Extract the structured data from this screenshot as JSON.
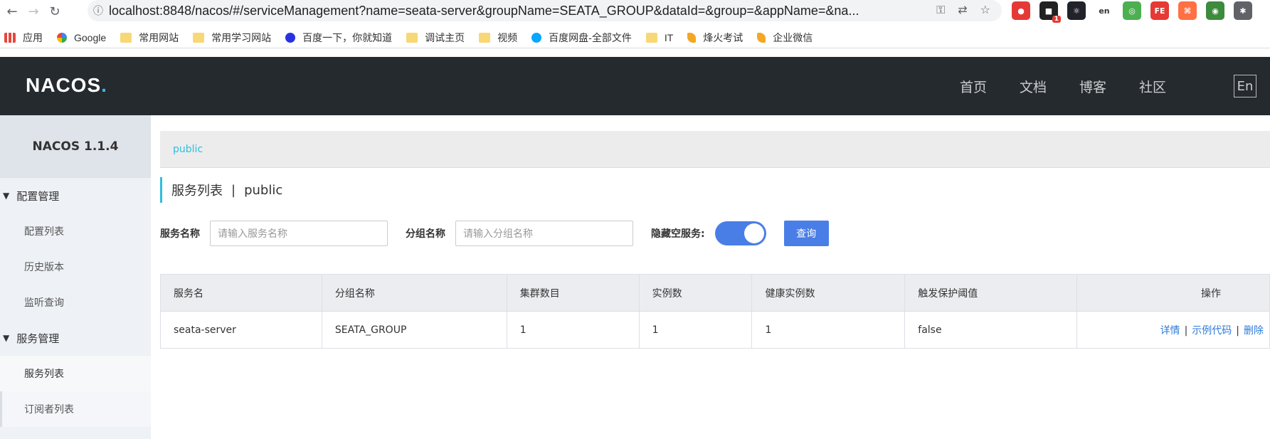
{
  "browser": {
    "url": "localhost:8848/nacos/#/serviceManagement?name=seata-server&groupName=SEATA_GROUP&dataId=&group=&appName=&na...",
    "extensions": [
      {
        "name": "adblock-icon",
        "label": "●",
        "color": "#e53935"
      },
      {
        "name": "notification-ext-icon",
        "label": "■",
        "color": "#222222",
        "badge": "1"
      },
      {
        "name": "react-devtools-icon",
        "label": "⚛",
        "color": "#20232a"
      },
      {
        "name": "translate-ext-icon",
        "label": "en",
        "color": "#ffffff"
      },
      {
        "name": "target-ext-icon",
        "label": "◎",
        "color": "#4caf50"
      },
      {
        "name": "fe-ext-icon",
        "label": "FE",
        "color": "#e53935"
      },
      {
        "name": "sitemap-ext-icon",
        "label": "⌘",
        "color": "#ff7043"
      },
      {
        "name": "ie-tab-icon",
        "label": "◉",
        "color": "#3d8b3d"
      },
      {
        "name": "puzzle-icon",
        "label": "✱",
        "color": "#5f6368"
      }
    ]
  },
  "bookmarks": [
    {
      "label": "应用",
      "icon": "apps-icon"
    },
    {
      "label": "Google",
      "icon": "google-icon"
    },
    {
      "label": "常用网站",
      "icon": "folder-icon"
    },
    {
      "label": "常用学习网站",
      "icon": "folder-icon"
    },
    {
      "label": "百度一下，你就知道",
      "icon": "baidu-icon"
    },
    {
      "label": "调试主页",
      "icon": "folder-icon"
    },
    {
      "label": "视频",
      "icon": "folder-icon"
    },
    {
      "label": "百度网盘-全部文件",
      "icon": "baidu-pan-icon"
    },
    {
      "label": "IT",
      "icon": "folder-icon"
    },
    {
      "label": "烽火考试",
      "icon": "flame-icon"
    },
    {
      "label": "企业微信",
      "icon": "flame-icon"
    }
  ],
  "header": {
    "logo": "NACOS",
    "nav": [
      "首页",
      "文档",
      "博客",
      "社区"
    ],
    "lang": "En"
  },
  "sidebar": {
    "title": "NACOS 1.1.4",
    "config_group": "配置管理",
    "config_items": [
      "配置列表",
      "历史版本",
      "监听查询"
    ],
    "service_group": "服务管理",
    "service_items": [
      "服务列表",
      "订阅者列表"
    ]
  },
  "main": {
    "namespace": "public",
    "title": "服务列表",
    "title_ns": "public",
    "filter": {
      "service_label": "服务名称",
      "service_placeholder": "请输入服务名称",
      "group_label": "分组名称",
      "group_placeholder": "请输入分组名称",
      "hide_empty_label": "隐藏空服务:",
      "query_button": "查询"
    },
    "table": {
      "columns": [
        "服务名",
        "分组名称",
        "集群数目",
        "实例数",
        "健康实例数",
        "触发保护阈值",
        "操作"
      ],
      "rows": [
        {
          "name": "seata-server",
          "group": "SEATA_GROUP",
          "clusters": "1",
          "instances": "1",
          "healthy": "1",
          "threshold": "false"
        }
      ],
      "ops": [
        "详情",
        "示例代码",
        "删除"
      ]
    }
  }
}
